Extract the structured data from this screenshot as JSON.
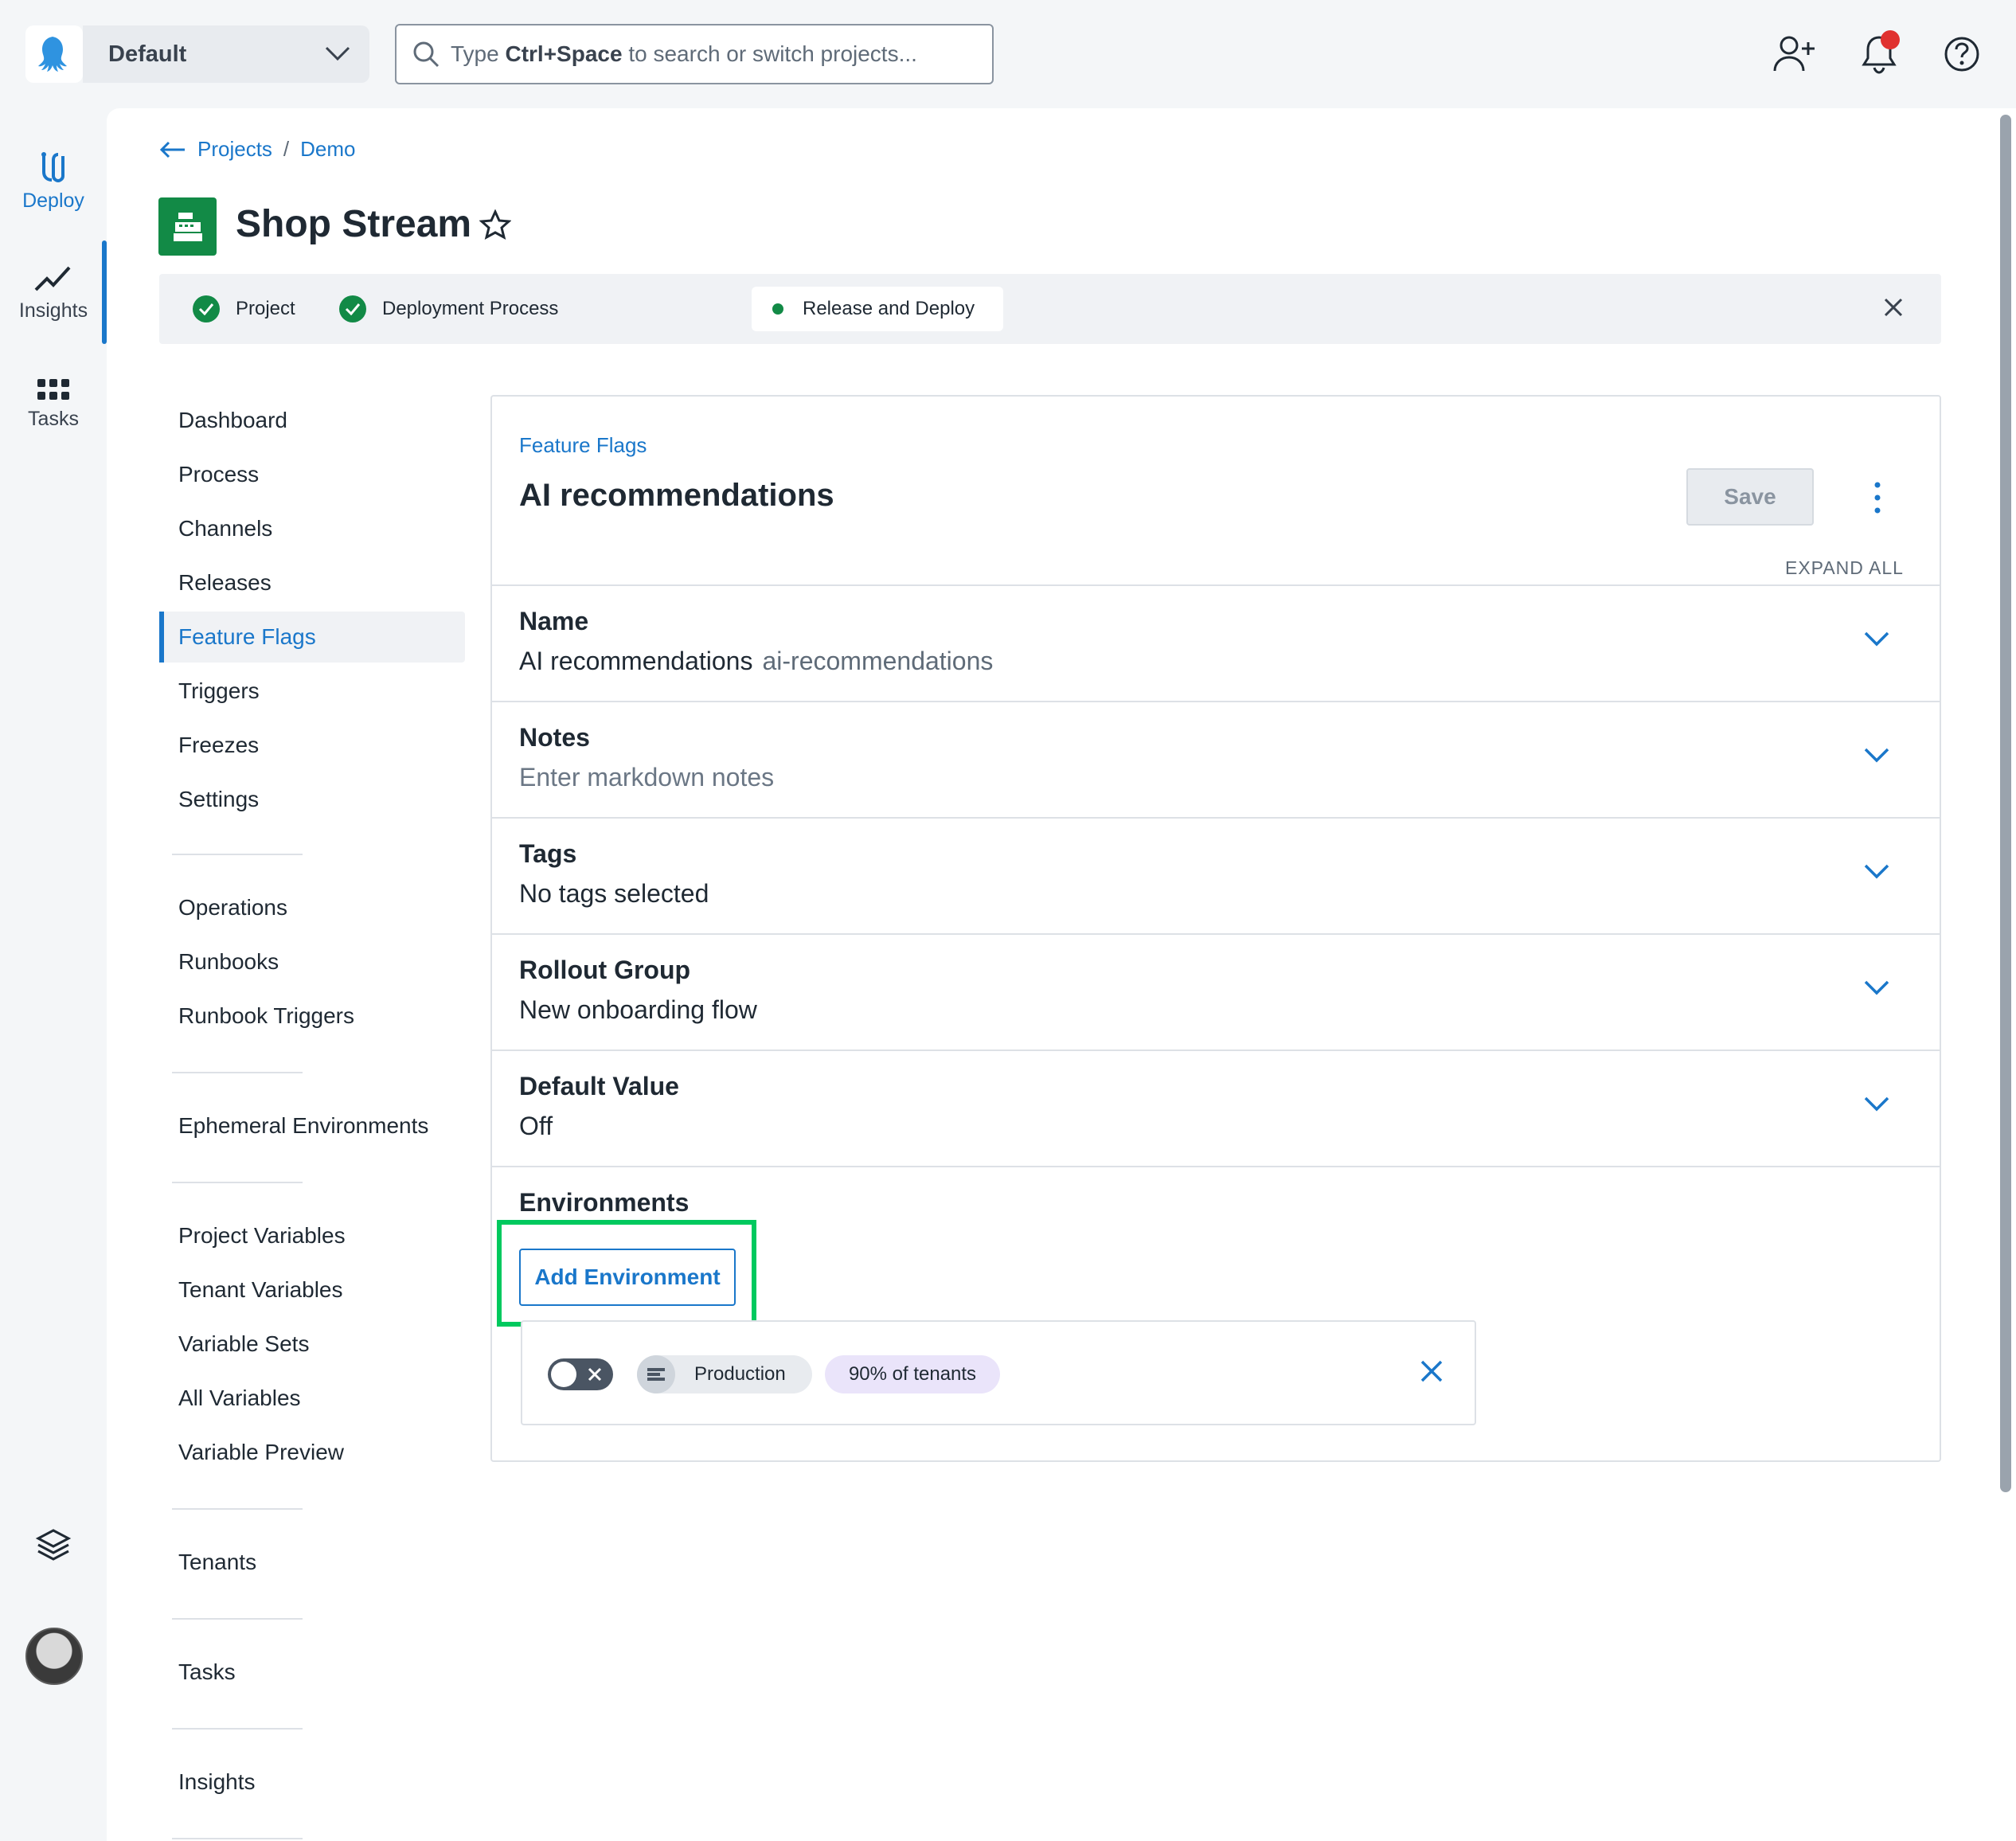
{
  "topbar": {
    "space_name": "Default",
    "search_placeholder_prefix": "Type",
    "search_shortcut": "Ctrl+Space",
    "search_placeholder_suffix": "to search or switch projects..."
  },
  "leftnav": {
    "items": [
      {
        "label": "Deploy",
        "icon": "deploy-icon",
        "active": true
      },
      {
        "label": "Insights",
        "icon": "insights-icon"
      },
      {
        "label": "Tasks",
        "icon": "tasks-icon"
      }
    ]
  },
  "breadcrumb": {
    "items": [
      "Projects",
      "Demo"
    ],
    "separator": "/"
  },
  "project": {
    "title": "Shop Stream"
  },
  "steps": [
    {
      "label": "Project",
      "state": "done"
    },
    {
      "label": "Deployment Process",
      "state": "done"
    },
    {
      "label": "Release and Deploy",
      "state": "current"
    }
  ],
  "subnav": {
    "groups": [
      [
        "Dashboard",
        "Process",
        "Channels",
        "Releases",
        "Feature Flags",
        "Triggers",
        "Freezes",
        "Settings"
      ],
      [
        "Operations",
        "Runbooks",
        "Runbook Triggers"
      ],
      [
        "Ephemeral Environments"
      ],
      [
        "Project Variables",
        "Tenant Variables",
        "Variable Sets",
        "All Variables",
        "Variable Preview"
      ],
      [
        "Tenants"
      ],
      [
        "Tasks"
      ],
      [
        "Insights"
      ]
    ],
    "active": "Feature Flags"
  },
  "card": {
    "crumb": "Feature Flags",
    "title": "AI recommendations",
    "save_label": "Save",
    "expand_all": "EXPAND ALL",
    "sections": [
      {
        "label": "Name",
        "value": "AI recommendations",
        "slug": "ai-recommendations"
      },
      {
        "label": "Notes",
        "value": "Enter markdown notes",
        "muted": true
      },
      {
        "label": "Tags",
        "value": "No tags selected"
      },
      {
        "label": "Rollout Group",
        "value": "New onboarding flow"
      },
      {
        "label": "Default Value",
        "value": "Off"
      }
    ],
    "environments": {
      "label": "Environments",
      "add_label": "Add Environment",
      "rows": [
        {
          "enabled": false,
          "environment": "Production",
          "tenants": "90% of tenants"
        }
      ]
    }
  },
  "colors": {
    "accent": "#1a77ca",
    "success": "#128a46",
    "highlight": "#00c95e",
    "notification": "#e0312f"
  }
}
